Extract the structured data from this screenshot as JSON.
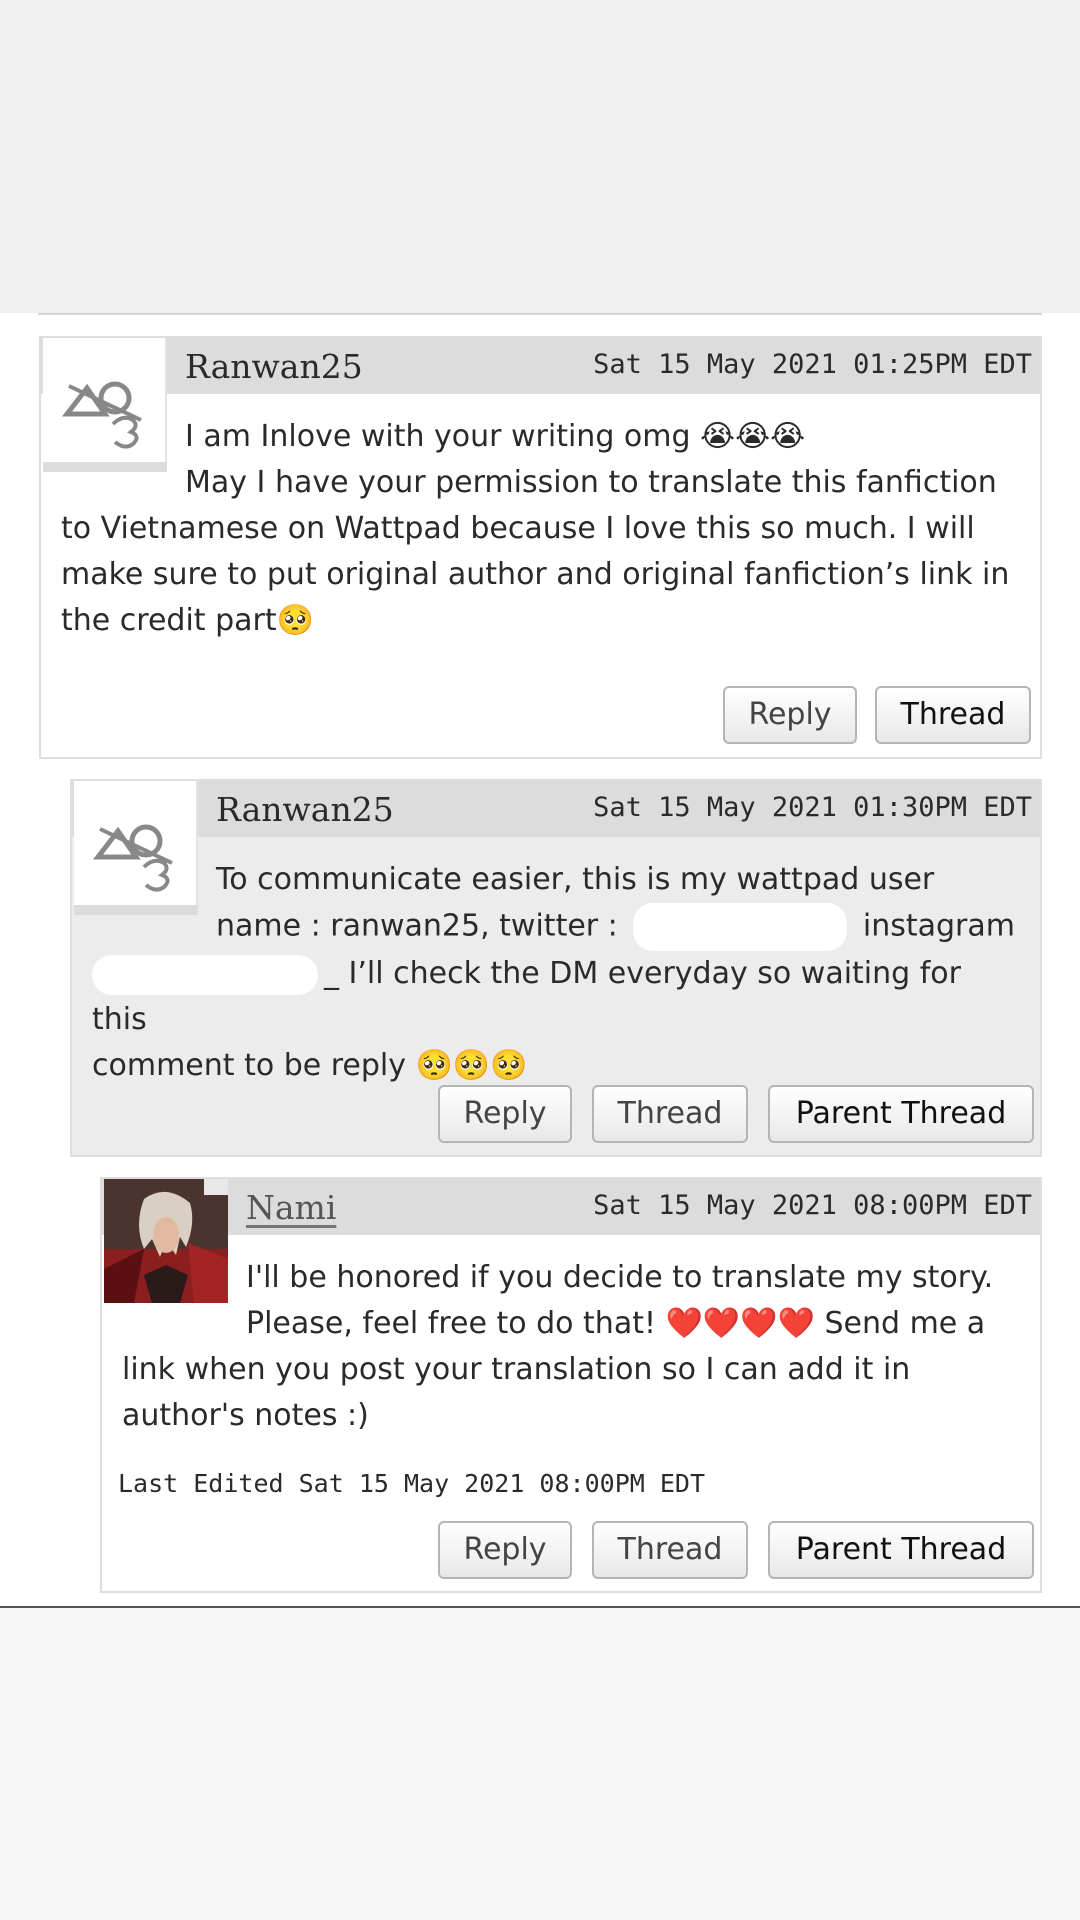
{
  "comments": [
    {
      "username": "Ranwan25",
      "date": "Sat 15 May 2021 01:25PM EDT",
      "text_line1": "I am Inlove with your writing omg 😭😭😭",
      "text_rest_indent": "May I have your permission to translate this fanfiction",
      "text_rest": "to Vietnamese on Wattpad because I love this so much. I will make sure to put original author and original fanfiction’s link in the credit part🥺",
      "buttons": {
        "reply": "Reply",
        "thread": "Thread"
      }
    },
    {
      "username": "Ranwan25",
      "date": "Sat 15 May 2021 01:30PM EDT",
      "text_line1": "To communicate easier, this is my wattpad user",
      "text_line2_a": "name : ranwan25, twitter :",
      "text_line2_b": "instagram",
      "text_line3": "_ I’ll check the DM everyday so waiting for this",
      "text_line4": "comment to be reply 🥺🥺🥺",
      "buttons": {
        "reply": "Reply",
        "thread": "Thread",
        "parent_thread": "Parent Thread"
      }
    },
    {
      "username": "Nami",
      "date": "Sat 15 May 2021 08:00PM EDT",
      "text_line1": "I'll be honored if you decide to translate my story.",
      "text_line2": "Please, feel free to do that! ❤️❤️❤️❤️ Send me a",
      "text_rest": "link when you post your translation so I can add it in author's notes :)",
      "last_edited": "Last Edited Sat 15 May 2021 08:00PM EDT",
      "buttons": {
        "reply": "Reply",
        "thread": "Thread",
        "parent_thread": "Parent Thread"
      }
    }
  ],
  "icons": {
    "default_avatar": "default-avatar-icon",
    "user_avatar": "user-avatar-photo"
  },
  "colors": {
    "header_bg": "#dcdcdc",
    "reply_bg": "#ececec",
    "page_top": "#efefef"
  }
}
